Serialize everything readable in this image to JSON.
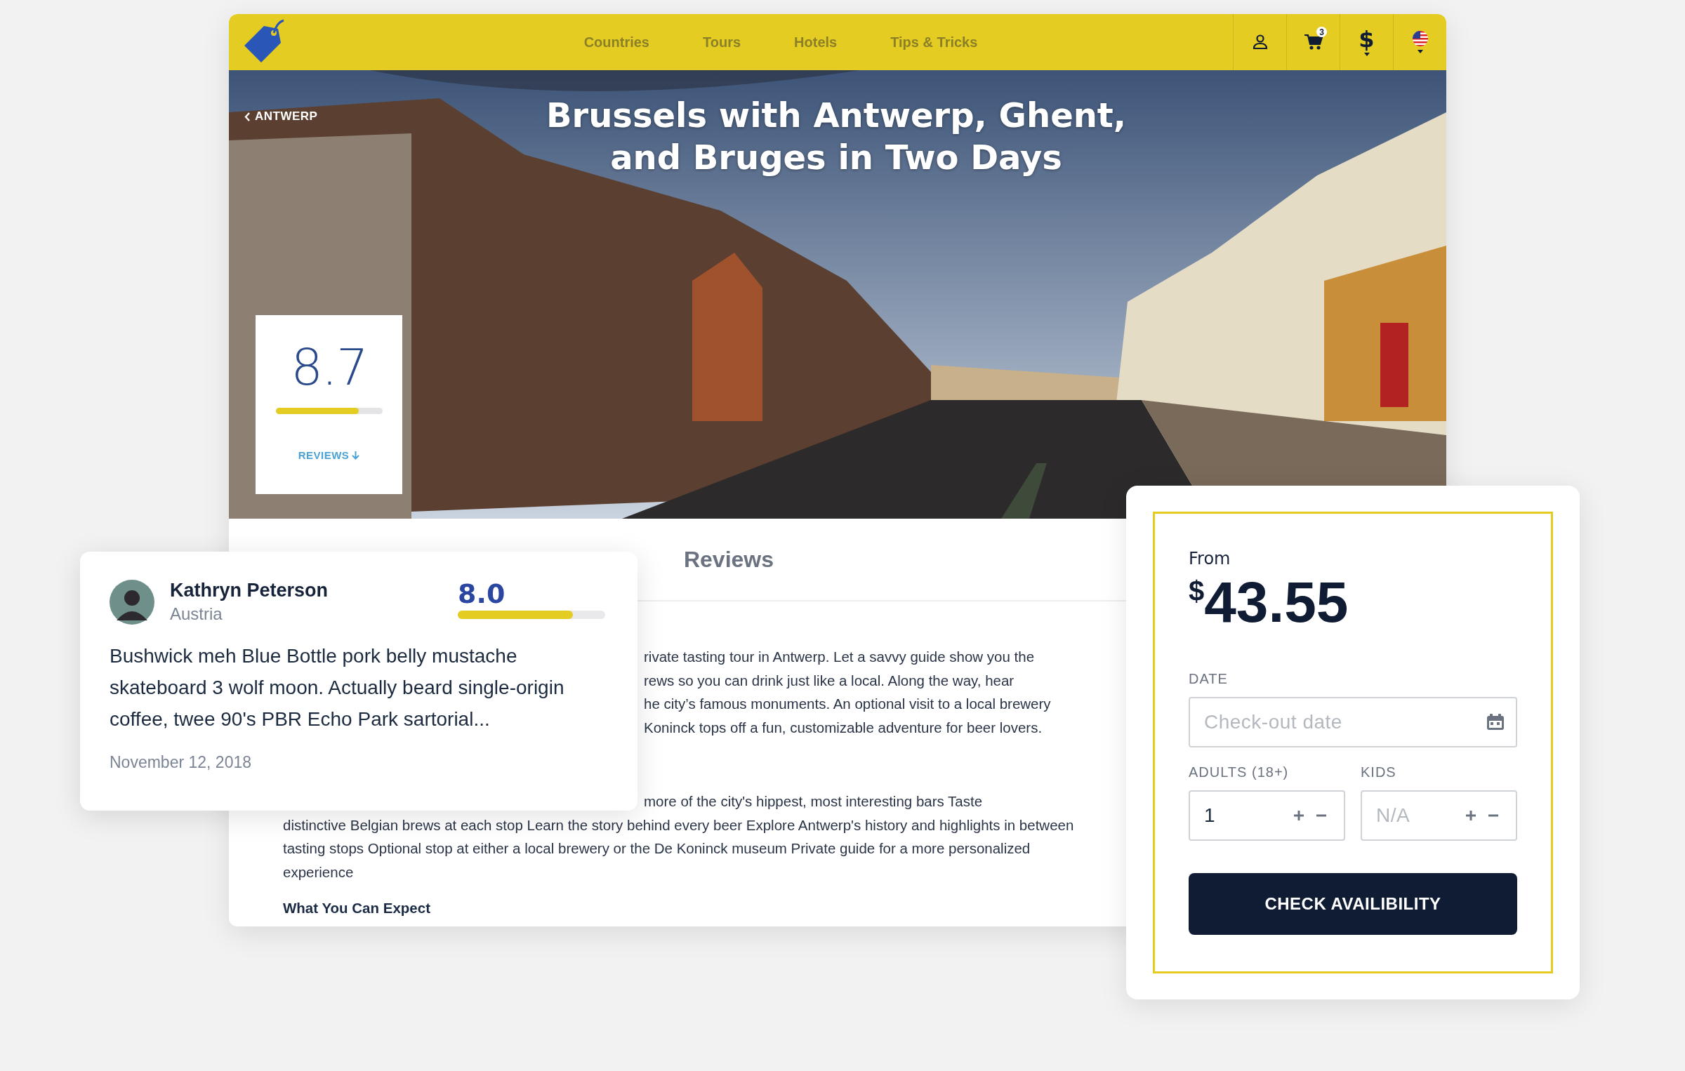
{
  "nav": {
    "links": [
      {
        "label": "Countries"
      },
      {
        "label": "Tours"
      },
      {
        "label": "Hotels"
      },
      {
        "label": "Tips & Tricks"
      }
    ],
    "cart_count": "3",
    "currency": "$"
  },
  "hero": {
    "back_link": "ANTWERP",
    "title": "Brussels with Antwerp, Ghent, and Bruges in Two Days",
    "rating": {
      "score": "8.7",
      "level": 0.78,
      "link": "REVIEWS"
    }
  },
  "reviews_heading": "Reviews",
  "description": {
    "paragraph_1_visible_lines": [
      "rivate tasting tour in Antwerp. Let a savvy guide show you the",
      "rews so you can drink just like a local. Along the way, hear",
      "he city’s famous monuments. An optional visit to a local brewery",
      "Koninck tops off a fun, customizable adventure for beer lovers."
    ],
    "paragraph_2_visible_part": "more of the city's hippest, most interesting bars Taste",
    "paragraph_2_rest": "distinctive Belgian brews at each stop Learn the story behind every beer Explore Antwerp's history and highlights in between tasting stops Optional stop at either a local brewery or the De Koninck museum Private guide for a more personalized experience",
    "subheading": "What You Can Expect"
  },
  "review": {
    "name": "Kathryn Peterson",
    "country": "Austria",
    "score": "8.0",
    "level": 0.78,
    "text": "Bushwick meh Blue Bottle pork belly mustache skateboard 3 wolf moon. Actually beard single-origin coffee, twee 90's PBR Echo Park sartorial...",
    "date": "November 12, 2018"
  },
  "booking": {
    "from_label": "From",
    "currency": "$",
    "price": "43.55",
    "date_label": "DATE",
    "date_placeholder": "Check-out date",
    "adults_label": "ADULTS (18+)",
    "adults_value": "1",
    "kids_label": "KIDS",
    "kids_placeholder": "N/A",
    "button": "CHECK AVAILIBILITY"
  }
}
